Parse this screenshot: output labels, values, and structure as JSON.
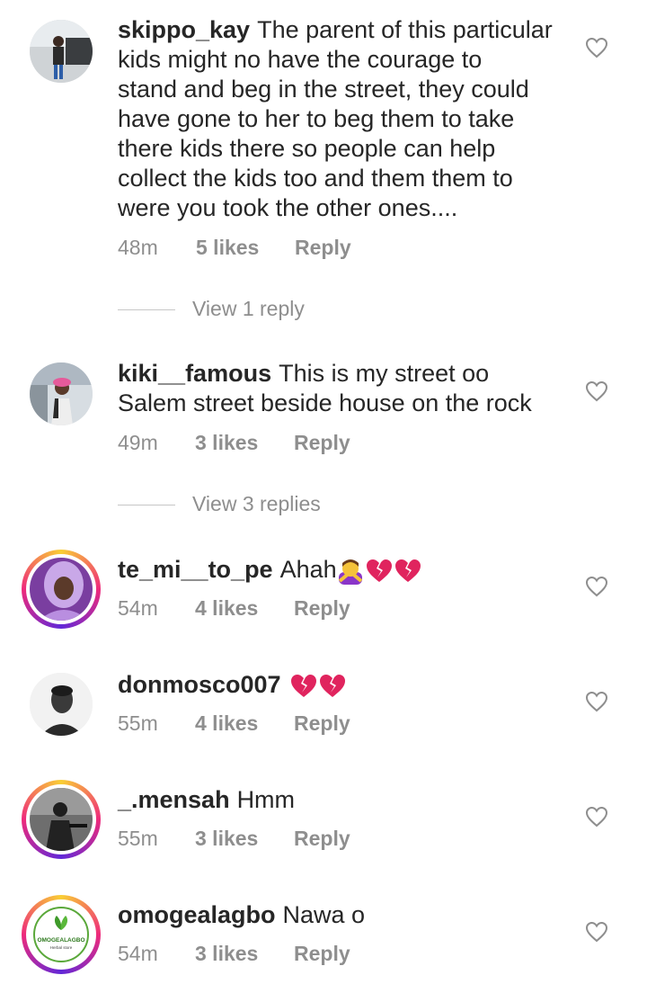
{
  "comments": [
    {
      "username": "skippo_kay",
      "lines": [
        "The parent of this particular",
        "kids might no have the courage to",
        "stand and beg in the street, they could",
        "have gone to her to beg them to take",
        "there kids there so people can help",
        "collect the kids too and them them to",
        "were you took the other ones...."
      ],
      "time": "48m",
      "likes": "5 likes",
      "reply": "Reply",
      "view_replies": "View 1 reply"
    },
    {
      "username": "kiki__famous",
      "lines": [
        "This is my street oo",
        "Salem street beside house on the rock"
      ],
      "time": "49m",
      "likes": "3 likes",
      "reply": "Reply",
      "view_replies": "View 3 replies"
    },
    {
      "username": "te_mi__to_pe",
      "text": "Ahah",
      "time": "54m",
      "likes": "4 likes",
      "reply": "Reply",
      "emojis": [
        "woman-gesturing-no",
        "broken-heart",
        "broken-heart"
      ]
    },
    {
      "username": "donmosco007",
      "text": "",
      "time": "55m",
      "likes": "4 likes",
      "reply": "Reply",
      "emojis": [
        "broken-heart",
        "broken-heart"
      ]
    },
    {
      "username": "_.mensah",
      "text": "Hmm",
      "time": "55m",
      "likes": "3 likes",
      "reply": "Reply"
    },
    {
      "username": "omogealagbo",
      "text": "Nawa o",
      "time": "54m",
      "likes": "3 likes",
      "reply": "Reply",
      "avatar_text": "OMOGEALAGBO",
      "avatar_subtext": "Herbal store"
    }
  ],
  "colors": {
    "text": "#262626",
    "meta": "#8e8e8e",
    "broken_heart": "#e0245e"
  }
}
